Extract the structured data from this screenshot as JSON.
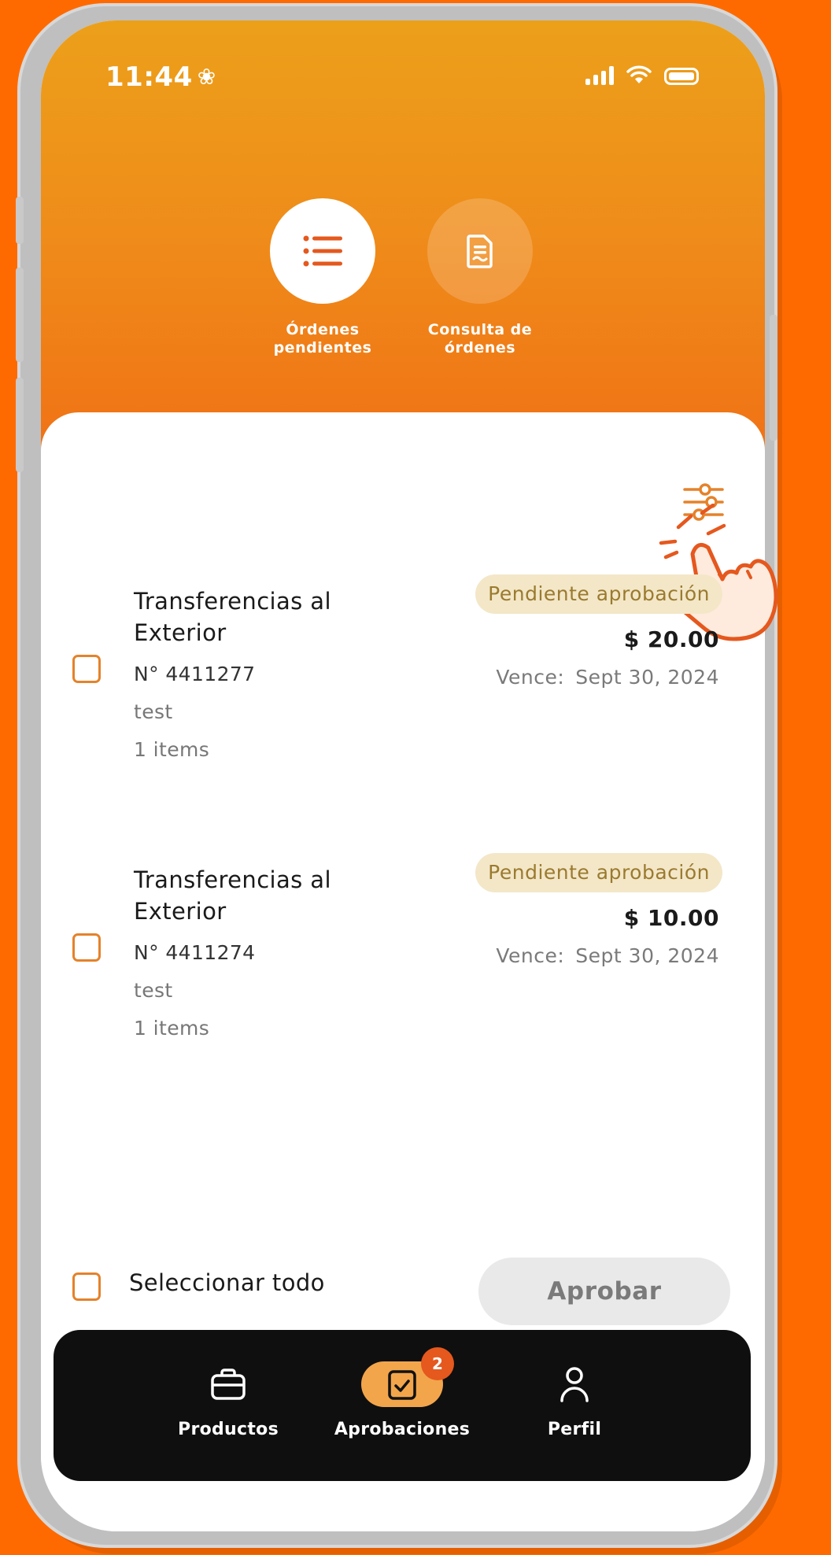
{
  "status_bar": {
    "time": "11:44",
    "time_icon": "flower-icon"
  },
  "top_nav": {
    "items": [
      {
        "label": "Órdenes\npendientes",
        "icon": "list-icon",
        "active": true
      },
      {
        "label": "Consulta de\nórdenes",
        "icon": "document-icon",
        "active": false
      }
    ]
  },
  "orders": [
    {
      "title": "Transferencias al Exterior",
      "number": "N° 4411277",
      "description": "test",
      "items": "1 items",
      "status": "Pendiente aprobación",
      "amount": "$ 20.00",
      "due_label": "Vence:",
      "due_date": "Sept 30, 2024"
    },
    {
      "title": "Transferencias al Exterior",
      "number": "N° 4411274",
      "description": "test",
      "items": "1 items",
      "status": "Pendiente aprobación",
      "amount": "$ 10.00",
      "due_label": "Vence:",
      "due_date": "Sept 30, 2024"
    }
  ],
  "footer": {
    "select_all_label": "Seleccionar todo",
    "approve_label": "Aprobar"
  },
  "bottom_nav": {
    "items": [
      {
        "label": "Productos",
        "icon": "briefcase-icon"
      },
      {
        "label": "Aprobaciones",
        "icon": "approval-check-icon",
        "badge": "2",
        "active": true
      },
      {
        "label": "Perfil",
        "icon": "user-icon"
      }
    ]
  },
  "colors": {
    "accent": "#F06D14",
    "background": "#FF6A00",
    "badge_bg": "#F3E7C8",
    "badge_text": "#9B7A2E"
  }
}
